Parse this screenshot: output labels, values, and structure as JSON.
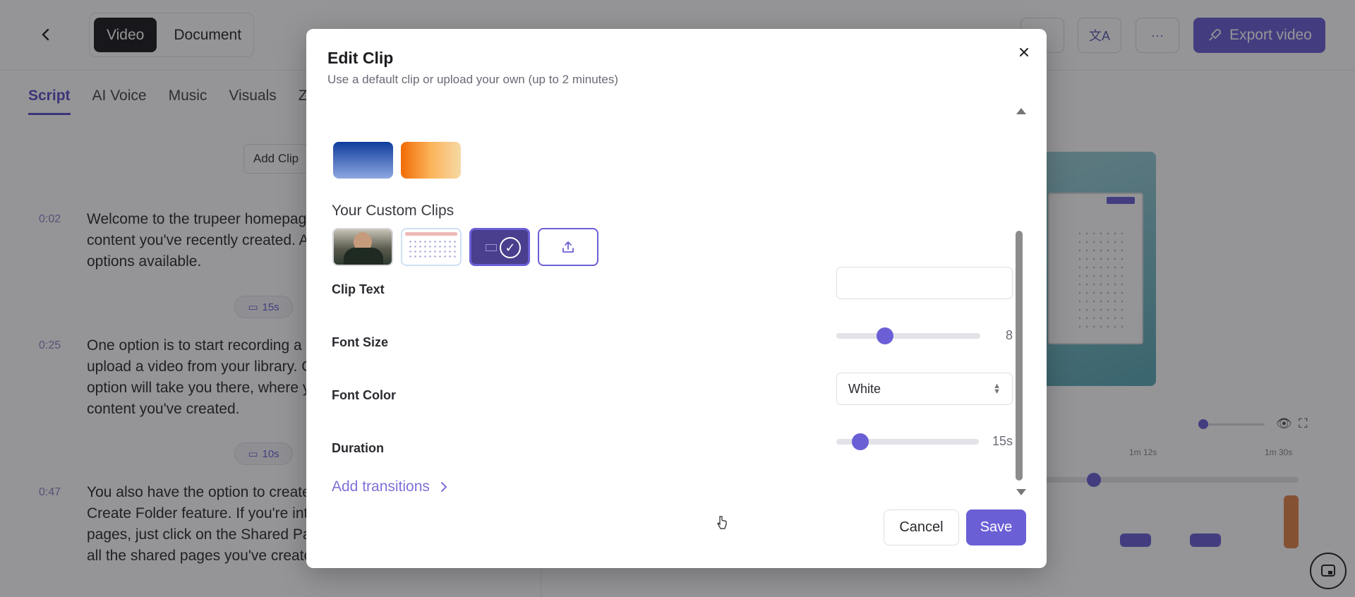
{
  "app": {
    "mode_tabs": [
      {
        "label": "Video",
        "active": true
      },
      {
        "label": "Document",
        "active": false
      }
    ],
    "export_label": "Export video",
    "nav_tabs": [
      {
        "label": "Script",
        "active": true
      },
      {
        "label": "AI Voice",
        "active": false
      },
      {
        "label": "Music",
        "active": false
      },
      {
        "label": "Visuals",
        "active": false
      },
      {
        "label": "Z",
        "active": false
      }
    ],
    "add_clip_label": "Add Clip",
    "script": [
      {
        "time": "0:02",
        "lines": [
          "Welcome to the trupeer homepag",
          "content you've recently created. A",
          "options available."
        ]
      },
      {
        "time": "0:25",
        "lines": [
          "One option is to start recording a r",
          "upload a video from your library. C",
          "option will take you there, where y",
          "content you've created."
        ]
      },
      {
        "time": "0:47",
        "lines": [
          "You also have the option to create",
          "Create Folder feature. If you're inte",
          "pages, just click on the Shared Pa",
          "all the shared pages you've create"
        ]
      }
    ],
    "clip_pills": [
      "15s",
      "10s"
    ],
    "timeline_labels": [
      "1m 12s",
      "1m 30s"
    ]
  },
  "modal": {
    "title": "Edit Clip",
    "subtitle": "Use a default clip or upload your own (up to 2 minutes)",
    "custom_clips_label": "Your Custom Clips",
    "clip_text": {
      "label": "Clip Text",
      "value": ""
    },
    "font_size": {
      "label": "Font Size",
      "value": "8",
      "level": 0.34
    },
    "font_color": {
      "label": "Font Color",
      "value": "White"
    },
    "duration": {
      "label": "Duration",
      "value": "15s",
      "level": 0.17
    },
    "add_transitions_label": "Add transitions",
    "cancel_label": "Cancel",
    "save_label": "Save",
    "colors": {
      "accent": "#6b5fd6",
      "swatch_blue": "#0f3c9c",
      "swatch_orange": "#f26b05"
    }
  }
}
